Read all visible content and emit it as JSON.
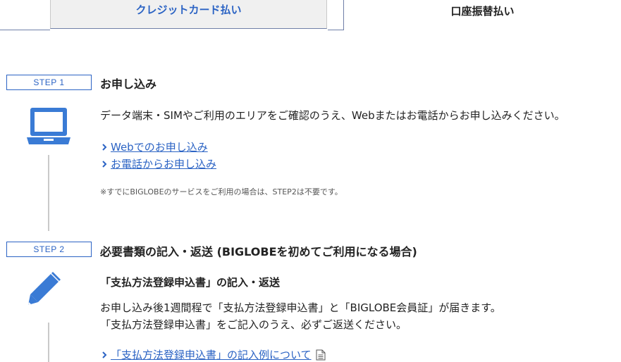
{
  "tabs": {
    "credit_card": "クレジットカード払い",
    "bank_transfer": "口座振替払い"
  },
  "step1": {
    "badge": "STEP 1",
    "title": "お申し込み",
    "description": "データ端末・SIMやご利用のエリアをご確認のうえ、Webまたはお電話からお申し込みください。",
    "links": [
      "Webでのお申し込み",
      "お電話からお申し込み"
    ],
    "note": "※すでにBIGLOBEのサービスをご利用の場合は、STEP2は不要です。",
    "icon": "laptop-icon"
  },
  "step2": {
    "badge": "STEP 2",
    "title": "必要書類の記入・返送 (BIGLOBEを初めてご利用になる場合)",
    "subheading": "「支払方法登録申込書」の記入・返送",
    "description_line1": "お申し込み後1週間程で「支払方法登録申込書」と「BIGLOBE会員証」が届きます。",
    "description_line2": "「支払方法登録申込書」をご記入のうえ、必ずご返送ください。",
    "link": "「支払方法登録申込書」の記入例について",
    "icon": "pencil-icon",
    "link_icon": "document-icon"
  },
  "colors": {
    "accent": "#2b63c4",
    "icon": "#3a7bd5",
    "line": "#c9c9c9"
  }
}
